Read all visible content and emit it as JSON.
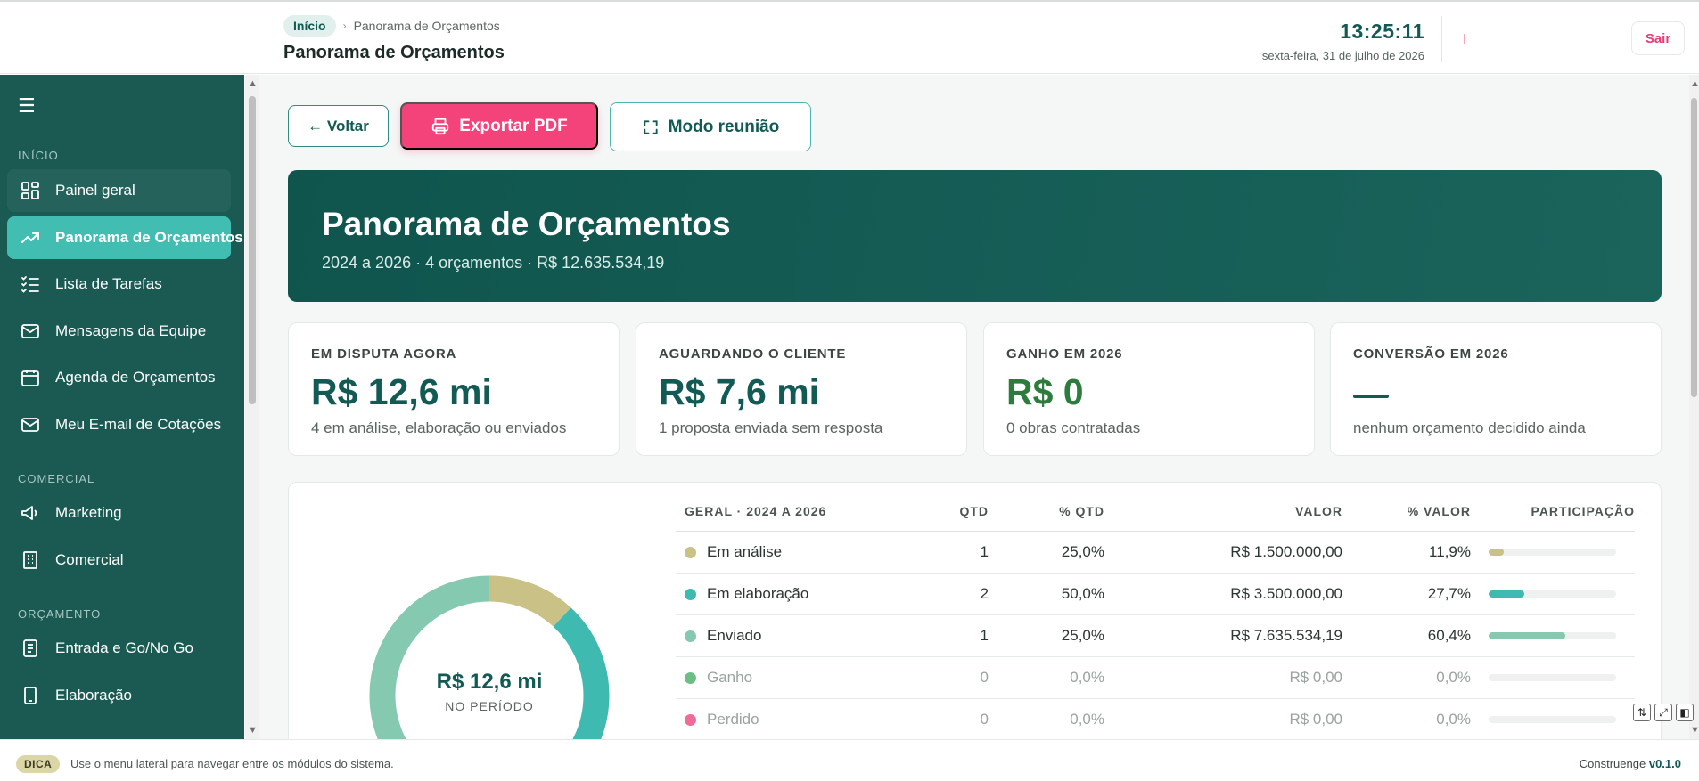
{
  "header": {
    "breadcrumb_home": "Início",
    "breadcrumb_current": "Panorama de Orçamentos",
    "title": "Panorama de Orçamentos",
    "time": "13:25:11",
    "date": "sexta-feira, 31 de julho de 2026",
    "logout_label": "Sair"
  },
  "sidebar": {
    "sections": {
      "inicio": "INÍCIO",
      "comercial": "COMERCIAL",
      "orcamento": "ORÇAMENTO"
    },
    "items": [
      {
        "label": "Painel geral",
        "icon": "dashboard-icon"
      },
      {
        "label": "Panorama de Orçamentos",
        "icon": "trending-up-icon",
        "active": true
      },
      {
        "label": "Lista de Tarefas",
        "icon": "checklist-icon"
      },
      {
        "label": "Mensagens da Equipe",
        "icon": "mail-icon"
      },
      {
        "label": "Agenda de Orçamentos",
        "icon": "calendar-icon"
      },
      {
        "label": "Meu E-mail de Cotações",
        "icon": "mail-icon"
      },
      {
        "label": "Marketing",
        "icon": "megaphone-icon"
      },
      {
        "label": "Comercial",
        "icon": "building-icon"
      },
      {
        "label": "Entrada e Go/No Go",
        "icon": "document-icon"
      },
      {
        "label": "Elaboração",
        "icon": "file-icon"
      }
    ]
  },
  "actions": {
    "back_label": "← Voltar",
    "pdf_label": "Exportar PDF",
    "meeting_label": "Modo reunião"
  },
  "hero": {
    "title": "Panorama de Orçamentos",
    "subtitle": "2024 a 2026 · 4 orçamentos · R$ 12.635.534,19"
  },
  "kpis": [
    {
      "label": "EM DISPUTA AGORA",
      "value": "R$ 12,6 mi",
      "sub": "4 em análise, elaboração ou enviados"
    },
    {
      "label": "AGUARDANDO O CLIENTE",
      "value": "R$ 7,6 mi",
      "sub": "1 proposta enviada sem resposta"
    },
    {
      "label": "GANHO EM 2026",
      "value": "R$ 0",
      "sub": "0 obras contratadas"
    },
    {
      "label": "CONVERSÃO EM 2026",
      "value": "",
      "sub": "nenhum orçamento decidido ainda"
    }
  ],
  "donut": {
    "center_value": "R$ 12,6 mi",
    "center_label": "NO PERÍODO"
  },
  "table": {
    "headers": [
      "GERAL · 2024 A 2026",
      "QTD",
      "% QTD",
      "VALOR",
      "% VALOR",
      "PARTICIPAÇÃO"
    ],
    "rows": [
      {
        "status": "Em análise",
        "qtd": "1",
        "pct_qtd": "25,0%",
        "valor": "R$ 1.500.000,00",
        "pct_valor": "11,9%",
        "share": 0.119,
        "color": "#c9c185"
      },
      {
        "status": "Em elaboração",
        "qtd": "2",
        "pct_qtd": "50,0%",
        "valor": "R$ 3.500.000,00",
        "pct_valor": "27,7%",
        "share": 0.277,
        "color": "#3fbab1"
      },
      {
        "status": "Enviado",
        "qtd": "1",
        "pct_qtd": "25,0%",
        "valor": "R$ 7.635.534,19",
        "pct_valor": "60,4%",
        "share": 0.604,
        "color": "#84c9b0"
      },
      {
        "status": "Ganho",
        "qtd": "0",
        "pct_qtd": "0,0%",
        "valor": "R$ 0,00",
        "pct_valor": "0,0%",
        "share": 0,
        "color": "#6bbf84"
      },
      {
        "status": "Perdido",
        "qtd": "0",
        "pct_qtd": "0,0%",
        "valor": "R$ 0,00",
        "pct_valor": "0,0%",
        "share": 0,
        "color": "#f06a9a"
      }
    ]
  },
  "footer": {
    "tip_badge": "DICA",
    "tip_text": "Use o menu lateral para navegar entre os módulos do sistema.",
    "brand": "Construenge",
    "version": "v0.1.0"
  },
  "colors": {
    "primary": "#125a54",
    "sidebar": "#1a5a53",
    "active": "#42bdb2",
    "accent_pink": "#f4427a"
  }
}
